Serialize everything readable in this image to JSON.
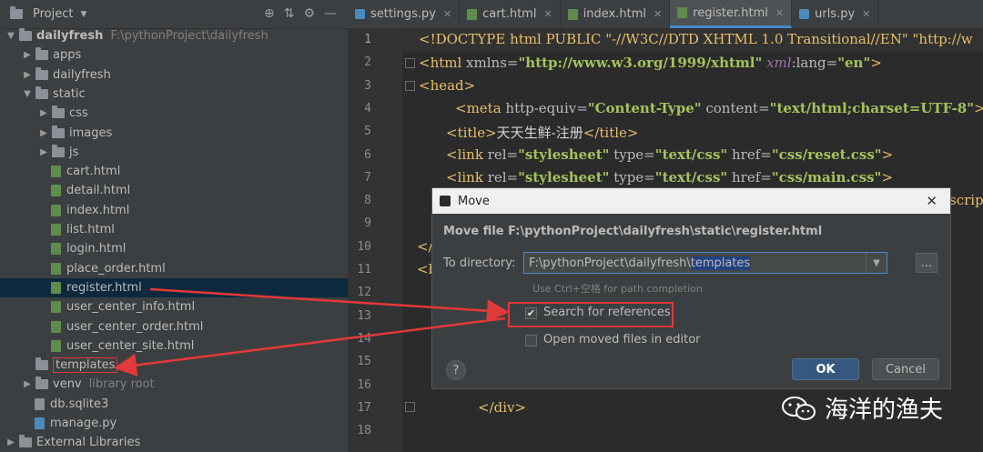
{
  "project_panel": {
    "title": "Project",
    "tree": [
      {
        "kind": "folder",
        "open": true,
        "label": "dailyfresh",
        "hint": "F:\\pythonProject\\dailyfresh",
        "bold": true
      },
      {
        "kind": "folder",
        "open": false,
        "label": "apps"
      },
      {
        "kind": "folder",
        "open": false,
        "label": "dailyfresh"
      },
      {
        "kind": "folder",
        "open": true,
        "label": "static"
      },
      {
        "kind": "folder",
        "open": false,
        "label": "css"
      },
      {
        "kind": "folder",
        "open": false,
        "label": "images"
      },
      {
        "kind": "folder",
        "open": false,
        "label": "js"
      },
      {
        "kind": "file",
        "label": "cart.html"
      },
      {
        "kind": "file",
        "label": "detail.html"
      },
      {
        "kind": "file",
        "label": "index.html"
      },
      {
        "kind": "file",
        "label": "list.html"
      },
      {
        "kind": "file",
        "label": "login.html"
      },
      {
        "kind": "file",
        "label": "place_order.html"
      },
      {
        "kind": "file",
        "label": "register.html",
        "selected": true
      },
      {
        "kind": "file",
        "label": "user_center_info.html"
      },
      {
        "kind": "file",
        "label": "user_center_order.html"
      },
      {
        "kind": "file",
        "label": "user_center_site.html"
      },
      {
        "kind": "folder",
        "label": "templates",
        "highlight": true
      },
      {
        "kind": "folder",
        "open": false,
        "label": "venv",
        "hint": "library root"
      },
      {
        "kind": "db",
        "label": "db.sqlite3"
      },
      {
        "kind": "py",
        "label": "manage.py"
      },
      {
        "kind": "lib",
        "label": "External Libraries"
      }
    ]
  },
  "tabs": [
    {
      "label": "settings.py",
      "type": "py"
    },
    {
      "label": "cart.html",
      "type": "html"
    },
    {
      "label": "index.html",
      "type": "html"
    },
    {
      "label": "register.html",
      "type": "html",
      "active": true
    },
    {
      "label": "urls.py",
      "type": "py"
    }
  ],
  "editor": {
    "line_numbers": [
      "1",
      "2",
      "3",
      "4",
      "5",
      "6",
      "7",
      "8",
      "9",
      "10",
      "11",
      "12",
      "13",
      "14",
      "15",
      "16",
      "17",
      "18"
    ],
    "lines": {
      "l1": "<!DOCTYPE html PUBLIC \"-//W3C//DTD XHTML 1.0 Transitional//EN\" \"http://w",
      "l2_tag": "<html ",
      "l2_attr": "xmlns=",
      "l2_str": "\"http://www.w3.org/1999/xhtml\"",
      "l2_attr2": " xml",
      "l2_rest": ":lang=",
      "l2_str2": "\"en\"",
      "l2_end": ">",
      "l3": "<head>",
      "l4_tag": "<meta ",
      "l4_attr": "http-equiv=",
      "l4_str": "\"Content-Type\"",
      "l4_attr2": " content=",
      "l4_str2": "\"text/html;charset=UTF-8\"",
      "l4_end": ">",
      "l5_tag": "<title>",
      "l5_txt": "天天生鲜-注册",
      "l5_end": "</title>",
      "l6_tag": "<link ",
      "l6_attr": "rel=",
      "l6_str": "\"stylesheet\"",
      "l6_attr2": " type=",
      "l6_str2": "\"text/css\"",
      "l6_attr3": " href=",
      "l6_str3": "\"css/reset.css\"",
      "l6_end": ">",
      "l7_str3": "\"css/main.css\"",
      "l8_tail": "scrip",
      "l10": "</",
      "l11": "<b",
      "l17": "</div>"
    }
  },
  "dialog": {
    "title": "Move",
    "heading": "Move file F:\\pythonProject\\dailyfresh\\static\\register.html",
    "to_directory_label": "To directory:",
    "dir_prefix": "F:\\pythonProject\\dailyfresh\\",
    "dir_selected": "templates",
    "completion_hint": "Use Ctrl+空格 for path completion",
    "search_refs_label": "Search for references",
    "search_refs_checked": true,
    "open_moved_label": "Open moved files in editor",
    "open_moved_checked": false,
    "ok_label": "OK",
    "cancel_label": "Cancel",
    "browse_label": "...",
    "help_label": "?"
  },
  "annotation_color": "#e2393a",
  "watermark": {
    "text": "海洋的渔夫"
  }
}
